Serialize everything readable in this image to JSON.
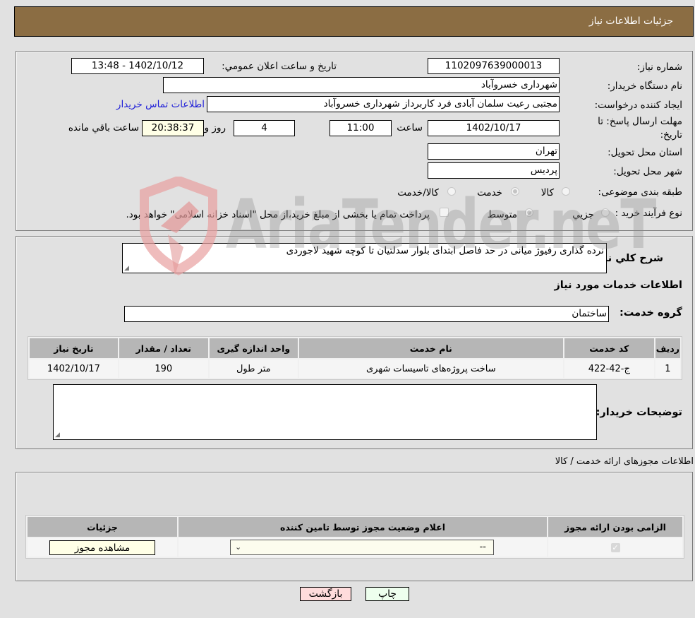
{
  "header": {
    "title": "جزئیات اطلاعات نیاز"
  },
  "need_info": {
    "need_number_label": "شماره نیاز:",
    "need_number": "1102097639000013",
    "announce_label": "تاریخ و ساعت اعلان عمومي:",
    "announce_value": "1402/10/12 - 13:48",
    "buyer_org_label": "نام دستگاه خریدار:",
    "buyer_org": "شهرداری خسروآباد",
    "creator_label": "ایجاد کننده درخواست:",
    "creator": "مجتبی رعیت سلمان آبادی فرد کاربرداز شهرداری خسروآباد",
    "buyer_contact_link": "اطلاعات تماس خریدار",
    "deadline_label_line1": "مهلت ارسال پاسخ: تا",
    "deadline_label_line2": "تاریخ:",
    "deadline_date": "1402/10/17",
    "time_label": "ساعت",
    "deadline_time": "11:00",
    "days_value": "4",
    "days_label": "روز و",
    "remaining_time": "20:38:37",
    "remaining_label": "ساعت باقي مانده",
    "province_label": "استان محل تحویل:",
    "province": "تهران",
    "city_label": "شهر محل تحویل:",
    "city": "پردیس",
    "category_label": "طبقه بندی موضوعی:",
    "category_options": [
      {
        "label": "کالا",
        "selected": false
      },
      {
        "label": "خدمت",
        "selected": true
      },
      {
        "label": "کالا/خدمت",
        "selected": false
      }
    ],
    "process_label": "نوع فرآیند خرید :",
    "process_options": [
      {
        "label": "جزیي",
        "selected": false
      },
      {
        "label": "متوسط",
        "selected": true
      }
    ],
    "treasury_checkbox_checked": false,
    "treasury_note": "پرداخت تمام یا بخشی از مبلغ خرید،از محل \"اسناد خزانه اسلامی\" خواهد بود."
  },
  "description": {
    "label": "شرح کلي نیاز:",
    "value": "نرده گذاری رفیوژ میانی در حد فاصل ابتدای بلوار سدلتیان تا کوچه شهید لاجوردی"
  },
  "services": {
    "section_title": "اطلاعات خدمات مورد نیاز",
    "group_label": "گروه خدمت:",
    "group_value": "ساختمان",
    "columns": [
      "ردیف",
      "کد خدمت",
      "نام خدمت",
      "واحد اندازه گیری",
      "تعداد / مقدار",
      "تاریخ نیاز"
    ],
    "rows": [
      {
        "row": "1",
        "code": "ج-42-422",
        "name": "ساخت پروژه‌های تاسیسات شهری",
        "unit": "متر طول",
        "qty": "190",
        "date": "1402/10/17"
      }
    ],
    "buyer_notes_label": "توضیحات خریدار:",
    "buyer_notes": ""
  },
  "permits": {
    "section_title": "اطلاعات مجوزهای ارائه خدمت / کالا",
    "columns": [
      "الزامی بودن ارائه مجوز",
      "اعلام وضعیت مجوز توسط تامین کننده",
      "جزئیات"
    ],
    "rows": [
      {
        "required_checked": true,
        "status_selected": "--",
        "details_button": "مشاهده مجوز"
      }
    ]
  },
  "footer": {
    "print_label": "چاپ",
    "back_label": "بازگشت"
  },
  "watermark": {
    "text": "AriaTender.neT"
  },
  "colors": {
    "header_bg": "#8b6d43",
    "link": "#1f1fd8",
    "back_btn": "#ffdcdc",
    "print_btn": "#eeffee"
  }
}
